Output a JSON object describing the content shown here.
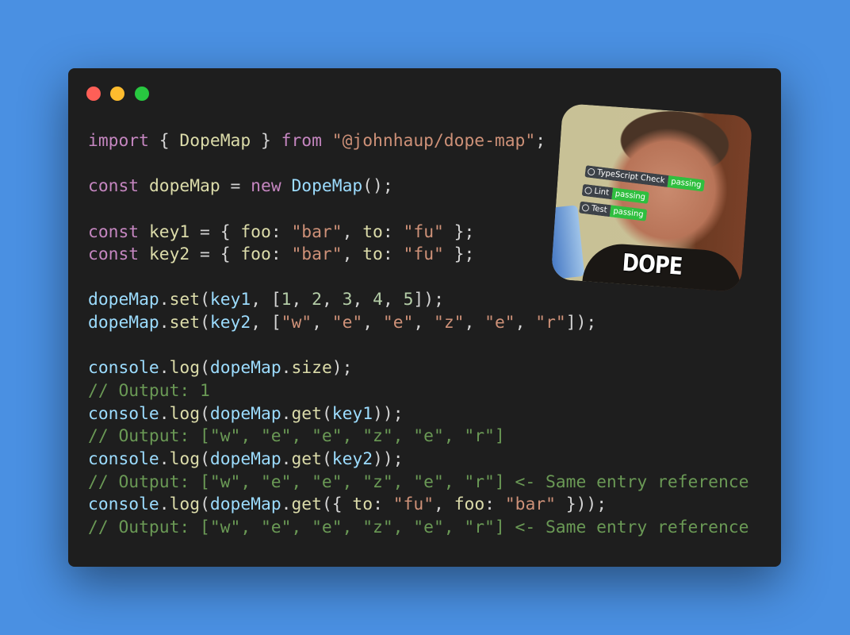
{
  "window": {
    "controls": [
      "close",
      "minimize",
      "maximize"
    ],
    "colors": {
      "close": "#ff5f57",
      "minimize": "#febc2e",
      "maximize": "#28c840",
      "background": "#1e1e1e",
      "page": "#4a90e2"
    }
  },
  "code": {
    "lines": [
      [
        [
          "kw",
          "import"
        ],
        [
          "punc",
          " { "
        ],
        [
          "fn",
          "DopeMap"
        ],
        [
          "punc",
          " } "
        ],
        [
          "kw",
          "from"
        ],
        [
          "punc",
          " "
        ],
        [
          "str",
          "\"@johnhaup/dope-map\""
        ],
        [
          "punc",
          ";"
        ]
      ],
      [],
      [
        [
          "kw",
          "const"
        ],
        [
          "punc",
          " "
        ],
        [
          "fn",
          "dopeMap"
        ],
        [
          "punc",
          " = "
        ],
        [
          "kw",
          "new"
        ],
        [
          "punc",
          " "
        ],
        [
          "var",
          "DopeMap"
        ],
        [
          "punc",
          "();"
        ]
      ],
      [],
      [
        [
          "kw",
          "const"
        ],
        [
          "punc",
          " "
        ],
        [
          "fn",
          "key1"
        ],
        [
          "punc",
          " = { "
        ],
        [
          "prop",
          "foo"
        ],
        [
          "punc",
          ": "
        ],
        [
          "str",
          "\"bar\""
        ],
        [
          "punc",
          ", "
        ],
        [
          "prop",
          "to"
        ],
        [
          "punc",
          ": "
        ],
        [
          "str",
          "\"fu\""
        ],
        [
          "punc",
          " };"
        ]
      ],
      [
        [
          "kw",
          "const"
        ],
        [
          "punc",
          " "
        ],
        [
          "fn",
          "key2"
        ],
        [
          "punc",
          " = { "
        ],
        [
          "prop",
          "foo"
        ],
        [
          "punc",
          ": "
        ],
        [
          "str",
          "\"bar\""
        ],
        [
          "punc",
          ", "
        ],
        [
          "prop",
          "to"
        ],
        [
          "punc",
          ": "
        ],
        [
          "str",
          "\"fu\""
        ],
        [
          "punc",
          " };"
        ]
      ],
      [],
      [
        [
          "var",
          "dopeMap"
        ],
        [
          "punc",
          "."
        ],
        [
          "fn",
          "set"
        ],
        [
          "punc",
          "("
        ],
        [
          "var",
          "key1"
        ],
        [
          "punc",
          ", ["
        ],
        [
          "num",
          "1"
        ],
        [
          "punc",
          ", "
        ],
        [
          "num",
          "2"
        ],
        [
          "punc",
          ", "
        ],
        [
          "num",
          "3"
        ],
        [
          "punc",
          ", "
        ],
        [
          "num",
          "4"
        ],
        [
          "punc",
          ", "
        ],
        [
          "num",
          "5"
        ],
        [
          "punc",
          "]);"
        ]
      ],
      [
        [
          "var",
          "dopeMap"
        ],
        [
          "punc",
          "."
        ],
        [
          "fn",
          "set"
        ],
        [
          "punc",
          "("
        ],
        [
          "var",
          "key2"
        ],
        [
          "punc",
          ", ["
        ],
        [
          "str",
          "\"w\""
        ],
        [
          "punc",
          ", "
        ],
        [
          "str",
          "\"e\""
        ],
        [
          "punc",
          ", "
        ],
        [
          "str",
          "\"e\""
        ],
        [
          "punc",
          ", "
        ],
        [
          "str",
          "\"z\""
        ],
        [
          "punc",
          ", "
        ],
        [
          "str",
          "\"e\""
        ],
        [
          "punc",
          ", "
        ],
        [
          "str",
          "\"r\""
        ],
        [
          "punc",
          "]);"
        ]
      ],
      [],
      [
        [
          "var",
          "console"
        ],
        [
          "punc",
          "."
        ],
        [
          "fn",
          "log"
        ],
        [
          "punc",
          "("
        ],
        [
          "var",
          "dopeMap"
        ],
        [
          "punc",
          "."
        ],
        [
          "fn",
          "size"
        ],
        [
          "punc",
          ");"
        ]
      ],
      [
        [
          "cmt",
          "// Output: 1"
        ]
      ],
      [
        [
          "var",
          "console"
        ],
        [
          "punc",
          "."
        ],
        [
          "fn",
          "log"
        ],
        [
          "punc",
          "("
        ],
        [
          "var",
          "dopeMap"
        ],
        [
          "punc",
          "."
        ],
        [
          "fn",
          "get"
        ],
        [
          "punc",
          "("
        ],
        [
          "var",
          "key1"
        ],
        [
          "punc",
          "));"
        ]
      ],
      [
        [
          "cmt",
          "// Output: [\"w\", \"e\", \"e\", \"z\", \"e\", \"r\"]"
        ]
      ],
      [
        [
          "var",
          "console"
        ],
        [
          "punc",
          "."
        ],
        [
          "fn",
          "log"
        ],
        [
          "punc",
          "("
        ],
        [
          "var",
          "dopeMap"
        ],
        [
          "punc",
          "."
        ],
        [
          "fn",
          "get"
        ],
        [
          "punc",
          "("
        ],
        [
          "var",
          "key2"
        ],
        [
          "punc",
          "));"
        ]
      ],
      [
        [
          "cmt",
          "// Output: [\"w\", \"e\", \"e\", \"z\", \"e\", \"r\"] <- Same entry reference"
        ]
      ],
      [
        [
          "var",
          "console"
        ],
        [
          "punc",
          "."
        ],
        [
          "fn",
          "log"
        ],
        [
          "punc",
          "("
        ],
        [
          "var",
          "dopeMap"
        ],
        [
          "punc",
          "."
        ],
        [
          "fn",
          "get"
        ],
        [
          "punc",
          "({ "
        ],
        [
          "prop",
          "to"
        ],
        [
          "punc",
          ": "
        ],
        [
          "str",
          "\"fu\""
        ],
        [
          "punc",
          ", "
        ],
        [
          "prop",
          "foo"
        ],
        [
          "punc",
          ": "
        ],
        [
          "str",
          "\"bar\""
        ],
        [
          "punc",
          " }));"
        ]
      ],
      [
        [
          "cmt",
          "// Output: [\"w\", \"e\", \"e\", \"z\", \"e\", \"r\"] <- Same entry reference"
        ]
      ]
    ]
  },
  "meme": {
    "badges": [
      {
        "label": "TypeScript Check",
        "status": "passing",
        "icon": "github-icon"
      },
      {
        "label": "Lint",
        "status": "passing",
        "icon": "github-icon"
      },
      {
        "label": "Test",
        "status": "passing",
        "icon": "github-icon"
      }
    ],
    "caption": "DOPE"
  }
}
